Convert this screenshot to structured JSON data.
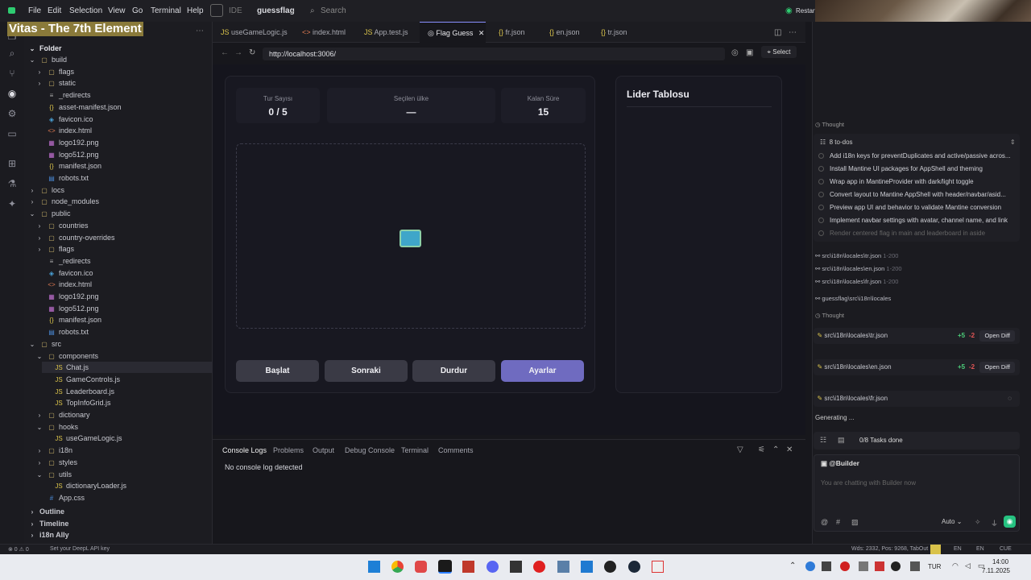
{
  "menu": {
    "items": [
      "File",
      "Edit",
      "Selection",
      "View",
      "Go",
      "Terminal",
      "Help"
    ],
    "ide_label": "IDE",
    "project": "guessflag",
    "search": "Search",
    "restart": "Restart"
  },
  "overlay_title": "Vitas - The 7th Element",
  "explorer": {
    "folder": "Folder",
    "rows": [
      {
        "label": "build",
        "kind": "folder",
        "depth": 0,
        "open": true
      },
      {
        "label": "flags",
        "kind": "folder",
        "depth": 1
      },
      {
        "label": "static",
        "kind": "folder",
        "depth": 1
      },
      {
        "label": "_redirects",
        "kind": "file",
        "depth": 1
      },
      {
        "label": "asset-manifest.json",
        "kind": "json",
        "depth": 1
      },
      {
        "label": "favicon.ico",
        "kind": "ico",
        "depth": 1
      },
      {
        "label": "index.html",
        "kind": "html",
        "depth": 1
      },
      {
        "label": "logo192.png",
        "kind": "img",
        "depth": 1
      },
      {
        "label": "logo512.png",
        "kind": "img",
        "depth": 1
      },
      {
        "label": "manifest.json",
        "kind": "json",
        "depth": 1
      },
      {
        "label": "robots.txt",
        "kind": "txt",
        "depth": 1
      },
      {
        "label": "locs",
        "kind": "folder",
        "depth": 0
      },
      {
        "label": "node_modules",
        "kind": "folder",
        "depth": 0
      },
      {
        "label": "public",
        "kind": "folder",
        "depth": 0,
        "open": true
      },
      {
        "label": "countries",
        "kind": "folder",
        "depth": 1
      },
      {
        "label": "country-overrides",
        "kind": "folder",
        "depth": 1
      },
      {
        "label": "flags",
        "kind": "folder",
        "depth": 1
      },
      {
        "label": "_redirects",
        "kind": "file",
        "depth": 1
      },
      {
        "label": "favicon.ico",
        "kind": "ico",
        "depth": 1
      },
      {
        "label": "index.html",
        "kind": "html",
        "depth": 1
      },
      {
        "label": "logo192.png",
        "kind": "img",
        "depth": 1
      },
      {
        "label": "logo512.png",
        "kind": "img",
        "depth": 1
      },
      {
        "label": "manifest.json",
        "kind": "json",
        "depth": 1
      },
      {
        "label": "robots.txt",
        "kind": "txt",
        "depth": 1
      },
      {
        "label": "src",
        "kind": "folder",
        "depth": 0,
        "open": true
      },
      {
        "label": "components",
        "kind": "folder",
        "depth": 1,
        "open": true
      },
      {
        "label": "Chat.js",
        "kind": "js",
        "depth": 2,
        "selected": true
      },
      {
        "label": "GameControls.js",
        "kind": "js",
        "depth": 2
      },
      {
        "label": "Leaderboard.js",
        "kind": "js",
        "depth": 2
      },
      {
        "label": "TopInfoGrid.js",
        "kind": "js",
        "depth": 2
      },
      {
        "label": "dictionary",
        "kind": "folder",
        "depth": 1
      },
      {
        "label": "hooks",
        "kind": "folder",
        "depth": 1,
        "open": true
      },
      {
        "label": "useGameLogic.js",
        "kind": "js",
        "depth": 2
      },
      {
        "label": "i18n",
        "kind": "folder",
        "depth": 1
      },
      {
        "label": "styles",
        "kind": "folder",
        "depth": 1
      },
      {
        "label": "utils",
        "kind": "folder",
        "depth": 1,
        "open": true
      },
      {
        "label": "dictionaryLoader.js",
        "kind": "js",
        "depth": 2
      },
      {
        "label": "App.css",
        "kind": "css",
        "depth": 1
      }
    ],
    "sections": [
      "Outline",
      "Timeline",
      "i18n Ally"
    ]
  },
  "tabs": [
    {
      "label": "useGameLogic.js",
      "kind": "JS"
    },
    {
      "label": "index.html",
      "kind": "<>"
    },
    {
      "label": "App.test.js",
      "kind": "JS"
    },
    {
      "label": "Flag Guess",
      "kind": "◎",
      "active": true
    },
    {
      "label": "fr.json",
      "kind": "{}"
    },
    {
      "label": "en.json",
      "kind": "{}"
    },
    {
      "label": "tr.json",
      "kind": "{}"
    }
  ],
  "browser": {
    "url": "http://localhost:3006/",
    "select": "Select"
  },
  "game": {
    "stats": [
      {
        "label": "Tur Sayısı",
        "value": "0 / 5"
      },
      {
        "label": "Seçilen ülke",
        "value": "—"
      },
      {
        "label": "Kalan Süre",
        "value": "15"
      }
    ],
    "buttons": [
      "Başlat",
      "Sonraki",
      "Durdur",
      "Ayarlar"
    ],
    "leaderboard": "Lider Tablosu"
  },
  "panel": {
    "tabs": [
      "Console Logs",
      "Problems",
      "Output",
      "Debug Console",
      "Terminal",
      "Comments"
    ],
    "message": "No console log detected"
  },
  "agent": {
    "thought": "Thought",
    "todos_title": "8 to-dos",
    "todos": [
      "Add i18n keys for preventDuplicates and active/passive acros...",
      "Install Mantine UI packages for AppShell and theming",
      "Wrap app in MantineProvider with dark/light toggle",
      "Convert layout to Mantine AppShell with header/navbar/asid...",
      "Preview app UI and behavior to validate Mantine conversion",
      "Implement navbar settings with avatar, channel name, and link",
      "Render centered flag in main and leaderboard in aside"
    ],
    "context": [
      {
        "path": "src\\i18n\\locales\\tr.json",
        "range": "1-200"
      },
      {
        "path": "src\\i18n\\locales\\en.json",
        "range": "1-200"
      },
      {
        "path": "src\\i18n\\locales\\fr.json",
        "range": "1-200"
      },
      {
        "path": "guessflag\\src\\i18n\\locales",
        "range": ""
      }
    ],
    "thought2": "Thought",
    "files": [
      {
        "path": "src\\i18n\\locales\\tr.json",
        "add": "+5",
        "del": "-2",
        "action": "Open Diff"
      },
      {
        "path": "src\\i18n\\locales\\en.json",
        "add": "+5",
        "del": "-2",
        "action": "Open Diff"
      },
      {
        "path": "src\\i18n\\locales\\fr.json",
        "add": "",
        "del": "",
        "action": ""
      }
    ],
    "generating": "Generating ...",
    "tasks": "0/8 Tasks done",
    "builder": "@Builder",
    "placeholder": "You are chatting with Builder now",
    "mode": "Auto"
  },
  "status": {
    "left": "⊗ 0 ⚠ 0",
    "deepl": "Set your DeepL API key",
    "right": "Wds: 2332, Pos: 9268, TabOut",
    "lang1": "EN",
    "lang2": "EN",
    "cue": "CUE"
  },
  "taskbar": {
    "lang": "TUR",
    "time": "14:00",
    "date": "7.11.2025"
  }
}
